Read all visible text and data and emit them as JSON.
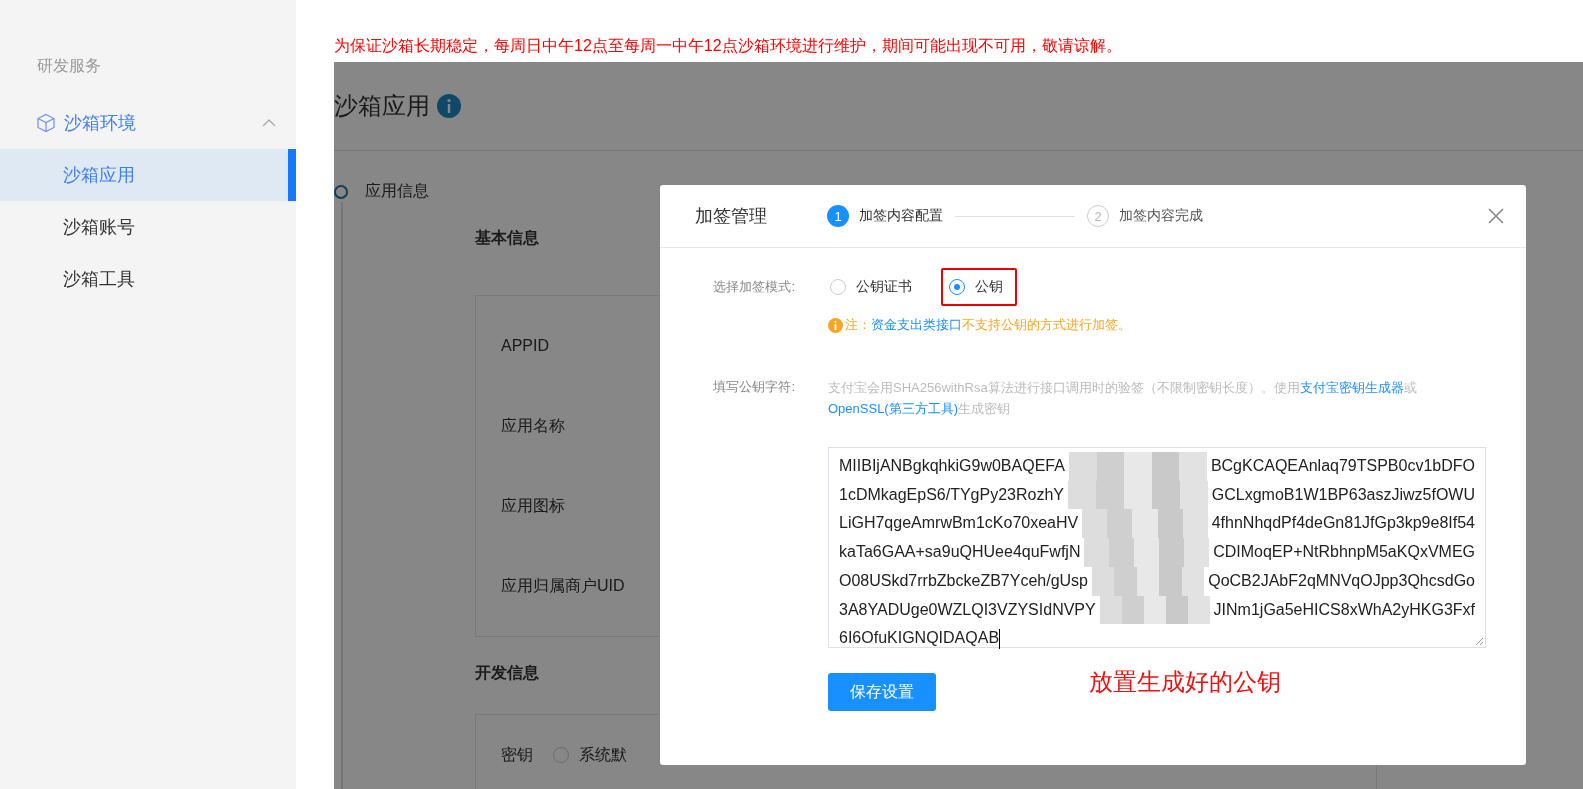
{
  "notice": "为保证沙箱长期稳定，每周日中午12点至每周一中午12点沙箱环境进行维护，期间可能出现不可用，敬请谅解。",
  "sidebar": {
    "section": "研发服务",
    "group": {
      "label": "沙箱环境",
      "expanded": true,
      "items": [
        {
          "label": "沙箱应用",
          "selected": true
        },
        {
          "label": "沙箱账号",
          "selected": false
        },
        {
          "label": "沙箱工具",
          "selected": false
        }
      ]
    }
  },
  "page": {
    "title": "沙箱应用",
    "step": "应用信息",
    "sections": [
      {
        "title": "基本信息",
        "rows": [
          {
            "kind": "field",
            "label": "APPID"
          },
          {
            "kind": "field",
            "label": "应用名称"
          },
          {
            "kind": "field",
            "label": "应用图标"
          },
          {
            "kind": "field",
            "label": "应用归属商户UID"
          }
        ]
      },
      {
        "title": "开发信息",
        "rows": [
          {
            "kind": "radio",
            "label": "密钥",
            "option": "系统默",
            "selected": false
          }
        ]
      }
    ]
  },
  "dialog": {
    "title": "加签管理",
    "steps": [
      {
        "number": "1",
        "label": "加签内容配置",
        "active": true
      },
      {
        "number": "2",
        "label": "加签内容完成",
        "active": false
      }
    ],
    "mode": {
      "label": "选择加签模式:",
      "options": [
        {
          "label": "公钥证书",
          "selected": false,
          "highlighted": false
        },
        {
          "label": "公钥",
          "selected": true,
          "highlighted": true
        }
      ]
    },
    "note": {
      "prefix": "注：",
      "link": "资金支出类接口",
      "suffix": "不支持公钥的方式进行加签。"
    },
    "key": {
      "label": "填写公钥字符:",
      "hint": [
        {
          "text": "支付宝会用SHA256withRsa算法进行接口调用时的验签（不限制密钥长度）。使用",
          "link": false
        },
        {
          "text": "支付宝密钥生成器",
          "link": true
        },
        {
          "text": "或",
          "link": false
        },
        {
          "text": "OpenSSL(第三方工具)",
          "link": true
        },
        {
          "text": "生成密钥",
          "link": false
        }
      ],
      "lines": [
        {
          "left": "MIIBIjANBgkqhkiG9w0BAQEFA",
          "right": "BCgKCAQEAnlaq79TSPB0cv1bDFO"
        },
        {
          "left": "1cDMkagEpS6/TYgPy23RozhY",
          "right": "GCLxgmoB1W1BP63aszJiwz5fOWU"
        },
        {
          "left": "LiGH7qgeAmrwBm1cKo70xeaHV",
          "right": "4fhnNhqdPf4deGn81JfGp3kp9e8If54"
        },
        {
          "left": "kaTa6GAA+sa9uQHUee4quFwfjN",
          "right": "CDIMoqEP+NtRbhnpM5aKQxVMEG"
        },
        {
          "left": "O08USkd7rrbZbckeZB7Yceh/gUsp",
          "right": "QoCB2JAbF2qMNVqOJpp3QhcsdGo"
        },
        {
          "left": "3A8YADUge0WZLQI3VZYSIdNVPY",
          "right": "JINm1jGa5eHICS8xWhA2yHKG3Fxf"
        },
        {
          "left": "6I6OfuKIGNQIDAQAB"
        }
      ]
    },
    "button": "保存设置",
    "annotation": "放置生成好的公钥"
  }
}
